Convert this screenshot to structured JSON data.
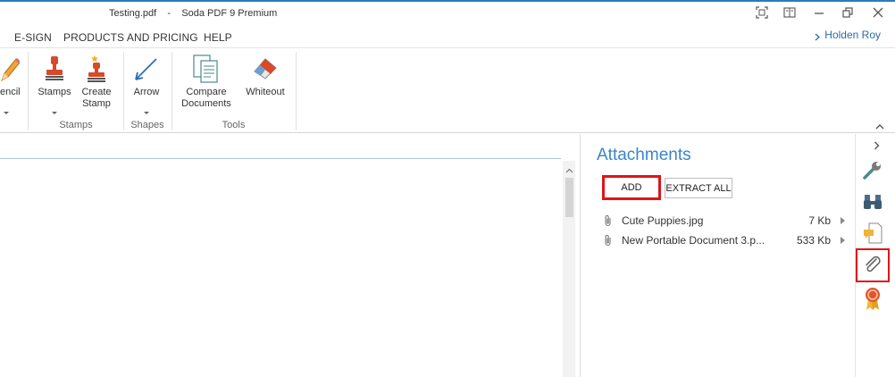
{
  "window": {
    "title": "Testing.pdf    -    Soda PDF 9 Premium"
  },
  "menu": {
    "items": [
      "E-SIGN",
      "PRODUCTS AND PRICING",
      "HELP"
    ],
    "user": "Holden Roy"
  },
  "ribbon": {
    "pencil_label": "encil",
    "stamps_label": "Stamps",
    "create_stamp_label_1": "Create",
    "create_stamp_label_2": "Stamp",
    "arrow_label": "Arrow",
    "compare_label_1": "Compare",
    "compare_label_2": "Documents",
    "whiteout_label": "Whiteout",
    "groups": {
      "stamps": "Stamps",
      "shapes": "Shapes",
      "tools": "Tools"
    }
  },
  "attachments": {
    "title": "Attachments",
    "add_label": "ADD",
    "extract_all_label": "EXTRACT ALL",
    "files": [
      {
        "name": "Cute Puppies.jpg",
        "size": "7 Kb"
      },
      {
        "name": "New Portable Document 3.p...",
        "size": "533 Kb"
      }
    ]
  },
  "sidebar": {
    "icons": [
      "wrench-icon",
      "binoculars-icon",
      "comment-page-icon",
      "paperclip-icon",
      "certificate-icon"
    ]
  },
  "colors": {
    "accent": "#3a86c6",
    "highlight": "#e0141a",
    "stamp_red": "#d64a2a",
    "arrow_blue": "#2c6db5"
  }
}
